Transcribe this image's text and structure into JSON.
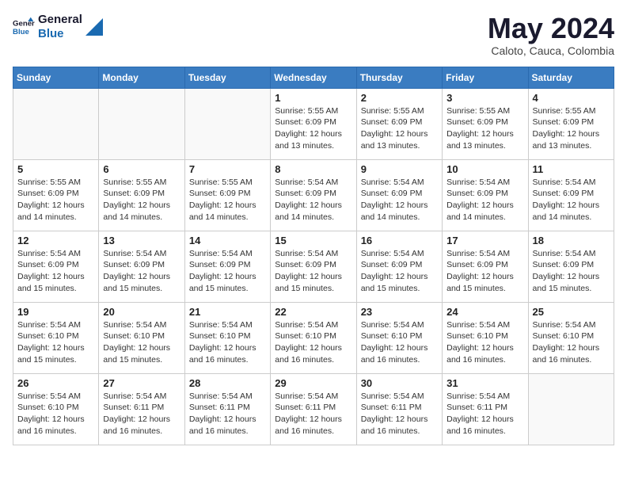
{
  "logo": {
    "line1": "General",
    "line2": "Blue"
  },
  "title": "May 2024",
  "location": "Caloto, Cauca, Colombia",
  "days_of_week": [
    "Sunday",
    "Monday",
    "Tuesday",
    "Wednesday",
    "Thursday",
    "Friday",
    "Saturday"
  ],
  "weeks": [
    [
      {
        "day": "",
        "info": ""
      },
      {
        "day": "",
        "info": ""
      },
      {
        "day": "",
        "info": ""
      },
      {
        "day": "1",
        "sunrise": "5:55 AM",
        "sunset": "6:09 PM",
        "daylight": "12 hours and 13 minutes."
      },
      {
        "day": "2",
        "sunrise": "5:55 AM",
        "sunset": "6:09 PM",
        "daylight": "12 hours and 13 minutes."
      },
      {
        "day": "3",
        "sunrise": "5:55 AM",
        "sunset": "6:09 PM",
        "daylight": "12 hours and 13 minutes."
      },
      {
        "day": "4",
        "sunrise": "5:55 AM",
        "sunset": "6:09 PM",
        "daylight": "12 hours and 13 minutes."
      }
    ],
    [
      {
        "day": "5",
        "sunrise": "5:55 AM",
        "sunset": "6:09 PM",
        "daylight": "12 hours and 14 minutes."
      },
      {
        "day": "6",
        "sunrise": "5:55 AM",
        "sunset": "6:09 PM",
        "daylight": "12 hours and 14 minutes."
      },
      {
        "day": "7",
        "sunrise": "5:55 AM",
        "sunset": "6:09 PM",
        "daylight": "12 hours and 14 minutes."
      },
      {
        "day": "8",
        "sunrise": "5:54 AM",
        "sunset": "6:09 PM",
        "daylight": "12 hours and 14 minutes."
      },
      {
        "day": "9",
        "sunrise": "5:54 AM",
        "sunset": "6:09 PM",
        "daylight": "12 hours and 14 minutes."
      },
      {
        "day": "10",
        "sunrise": "5:54 AM",
        "sunset": "6:09 PM",
        "daylight": "12 hours and 14 minutes."
      },
      {
        "day": "11",
        "sunrise": "5:54 AM",
        "sunset": "6:09 PM",
        "daylight": "12 hours and 14 minutes."
      }
    ],
    [
      {
        "day": "12",
        "sunrise": "5:54 AM",
        "sunset": "6:09 PM",
        "daylight": "12 hours and 15 minutes."
      },
      {
        "day": "13",
        "sunrise": "5:54 AM",
        "sunset": "6:09 PM",
        "daylight": "12 hours and 15 minutes."
      },
      {
        "day": "14",
        "sunrise": "5:54 AM",
        "sunset": "6:09 PM",
        "daylight": "12 hours and 15 minutes."
      },
      {
        "day": "15",
        "sunrise": "5:54 AM",
        "sunset": "6:09 PM",
        "daylight": "12 hours and 15 minutes."
      },
      {
        "day": "16",
        "sunrise": "5:54 AM",
        "sunset": "6:09 PM",
        "daylight": "12 hours and 15 minutes."
      },
      {
        "day": "17",
        "sunrise": "5:54 AM",
        "sunset": "6:09 PM",
        "daylight": "12 hours and 15 minutes."
      },
      {
        "day": "18",
        "sunrise": "5:54 AM",
        "sunset": "6:09 PM",
        "daylight": "12 hours and 15 minutes."
      }
    ],
    [
      {
        "day": "19",
        "sunrise": "5:54 AM",
        "sunset": "6:10 PM",
        "daylight": "12 hours and 15 minutes."
      },
      {
        "day": "20",
        "sunrise": "5:54 AM",
        "sunset": "6:10 PM",
        "daylight": "12 hours and 15 minutes."
      },
      {
        "day": "21",
        "sunrise": "5:54 AM",
        "sunset": "6:10 PM",
        "daylight": "12 hours and 16 minutes."
      },
      {
        "day": "22",
        "sunrise": "5:54 AM",
        "sunset": "6:10 PM",
        "daylight": "12 hours and 16 minutes."
      },
      {
        "day": "23",
        "sunrise": "5:54 AM",
        "sunset": "6:10 PM",
        "daylight": "12 hours and 16 minutes."
      },
      {
        "day": "24",
        "sunrise": "5:54 AM",
        "sunset": "6:10 PM",
        "daylight": "12 hours and 16 minutes."
      },
      {
        "day": "25",
        "sunrise": "5:54 AM",
        "sunset": "6:10 PM",
        "daylight": "12 hours and 16 minutes."
      }
    ],
    [
      {
        "day": "26",
        "sunrise": "5:54 AM",
        "sunset": "6:10 PM",
        "daylight": "12 hours and 16 minutes."
      },
      {
        "day": "27",
        "sunrise": "5:54 AM",
        "sunset": "6:11 PM",
        "daylight": "12 hours and 16 minutes."
      },
      {
        "day": "28",
        "sunrise": "5:54 AM",
        "sunset": "6:11 PM",
        "daylight": "12 hours and 16 minutes."
      },
      {
        "day": "29",
        "sunrise": "5:54 AM",
        "sunset": "6:11 PM",
        "daylight": "12 hours and 16 minutes."
      },
      {
        "day": "30",
        "sunrise": "5:54 AM",
        "sunset": "6:11 PM",
        "daylight": "12 hours and 16 minutes."
      },
      {
        "day": "31",
        "sunrise": "5:54 AM",
        "sunset": "6:11 PM",
        "daylight": "12 hours and 16 minutes."
      },
      {
        "day": "",
        "info": ""
      }
    ]
  ],
  "labels": {
    "sunrise": "Sunrise:",
    "sunset": "Sunset:",
    "daylight": "Daylight hours"
  }
}
